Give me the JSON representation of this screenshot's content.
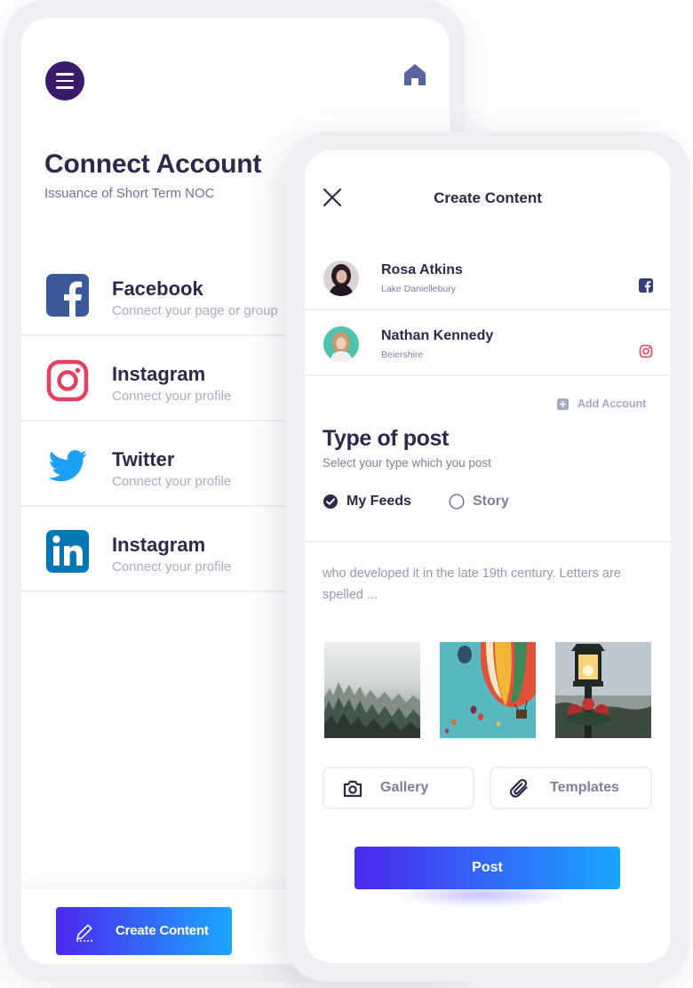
{
  "colors": {
    "primary_dark": "#2b2a4c",
    "accent_purple": "#3a1b6b",
    "gradient_start": "#4a28ee",
    "gradient_end": "#1aa7ff",
    "facebook": "#3b5998",
    "instagram": "#e4405f",
    "twitter": "#1da1f2",
    "linkedin": "#0077b5"
  },
  "back_screen": {
    "header": {
      "menu_icon": "hamburger-menu-icon",
      "home_icon": "home-icon"
    },
    "title": "Connect Account",
    "subtitle": "Issuance of Short Term NOC",
    "accounts": [
      {
        "icon": "facebook-icon",
        "name": "Facebook",
        "description": "Connect your page or group"
      },
      {
        "icon": "instagram-icon",
        "name": "Instagram",
        "description": "Connect your profile"
      },
      {
        "icon": "twitter-icon",
        "name": "Twitter",
        "description": "Connect your profile"
      },
      {
        "icon": "linkedin-icon",
        "name": "Instagram",
        "description": "Connect your profile"
      }
    ],
    "create_button": {
      "icon": "pencil-icon",
      "label": "Create Content"
    }
  },
  "front_screen": {
    "title": "Create Content",
    "close_icon": "close-icon",
    "people": [
      {
        "name": "Rosa Atkins",
        "location": "Lake Daniellebury",
        "network_icon": "facebook-icon"
      },
      {
        "name": "Nathan Kennedy",
        "location": "Beiershire",
        "network_icon": "instagram-icon"
      }
    ],
    "add_account_label": "Add Account",
    "type_of_post": {
      "title": "Type of post",
      "subtitle": "Select your type which you post",
      "options": [
        {
          "label": "My Feeds",
          "selected": true
        },
        {
          "label": "Story",
          "selected": false
        }
      ]
    },
    "caption": "who developed it in the late 19th century. Letters are spelled ...",
    "media": [
      {
        "icon": "forest-image"
      },
      {
        "icon": "hot-air-balloons-image"
      },
      {
        "icon": "street-lamp-image"
      }
    ],
    "tools": [
      {
        "icon": "camera-icon",
        "label": "Gallery"
      },
      {
        "icon": "paperclip-icon",
        "label": "Templates"
      }
    ],
    "post_label": "Post"
  }
}
